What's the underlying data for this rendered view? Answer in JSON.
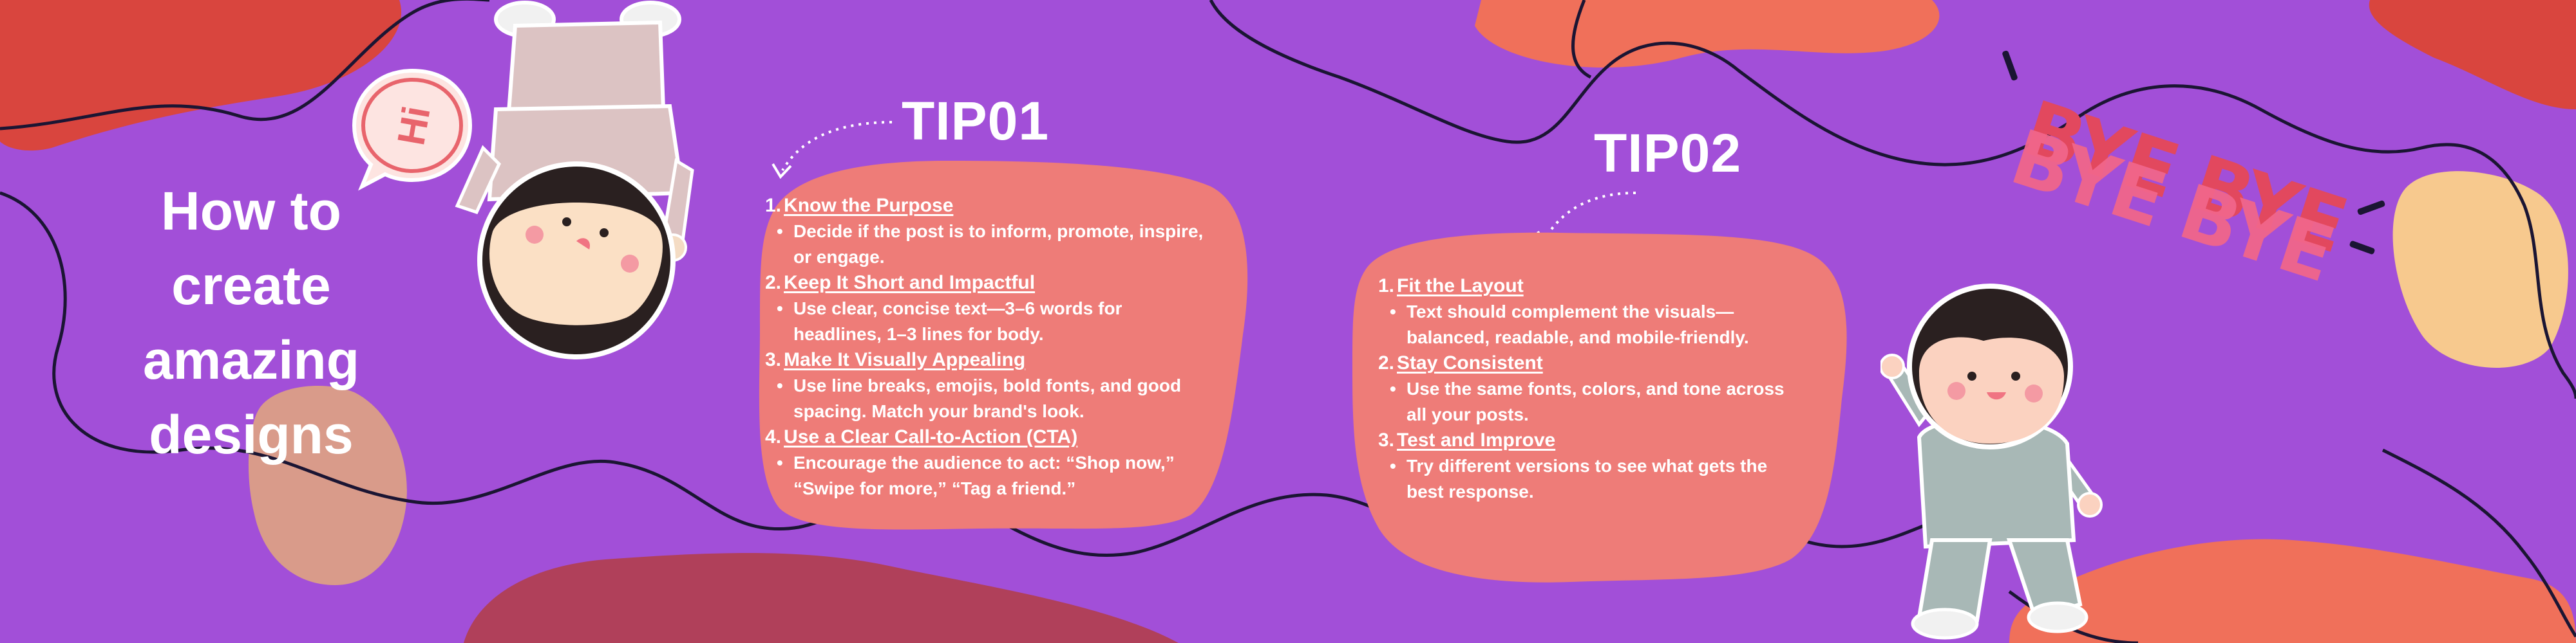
{
  "title": {
    "lines": [
      "How to",
      "create",
      "amazing",
      "designs"
    ]
  },
  "tip1": {
    "heading": "TIP01",
    "items": [
      {
        "num": "1.",
        "title": "Know the Purpose",
        "bullet_lines": [
          "Decide if the post is to inform, promote, inspire,",
          "or engage."
        ]
      },
      {
        "num": "2.",
        "title": "Keep It Short and Impactful",
        "bullet_lines": [
          "Use clear, concise text—3–6 words for",
          "headlines, 1–3 lines for body."
        ]
      },
      {
        "num": "3.",
        "title": "Make It Visually Appealing",
        "bullet_lines": [
          "Use line breaks, emojis, bold fonts, and good",
          "spacing. Match your brand's look."
        ]
      },
      {
        "num": "4.",
        "title": "Use a Clear Call-to-Action (CTA)",
        "bullet_lines": [
          "Encourage the audience to act: “Shop now,”",
          "“Swipe for more,” “Tag a friend.”"
        ]
      }
    ]
  },
  "tip2": {
    "heading": "TIP02",
    "items": [
      {
        "num": "1.",
        "title": "Fit the Layout",
        "bullet_lines": [
          "Text should complement the visuals—",
          "balanced, readable, and mobile-friendly."
        ]
      },
      {
        "num": "2.",
        "title": "Stay Consistent",
        "bullet_lines": [
          "Use the same fonts, colors, and tone across",
          "all your posts."
        ]
      },
      {
        "num": "3.",
        "title": "Test and Improve",
        "bullet_lines": [
          "Try different versions to see what gets the",
          "best response."
        ]
      }
    ]
  },
  "decor": {
    "bye_text_1": "BYE BYE",
    "bye_text_2": "BYE BYE",
    "speech_bubble_text": "Hi",
    "colors": {
      "background": "#a24fd8",
      "card": "#ee7c78",
      "blob_orange": "#f0705a",
      "blob_red": "#d9453e",
      "blob_peach": "#f7c98e",
      "blob_maroon": "#b0405a",
      "blob_tan": "#d99b8a",
      "bye_pink": "#f1668b"
    }
  }
}
